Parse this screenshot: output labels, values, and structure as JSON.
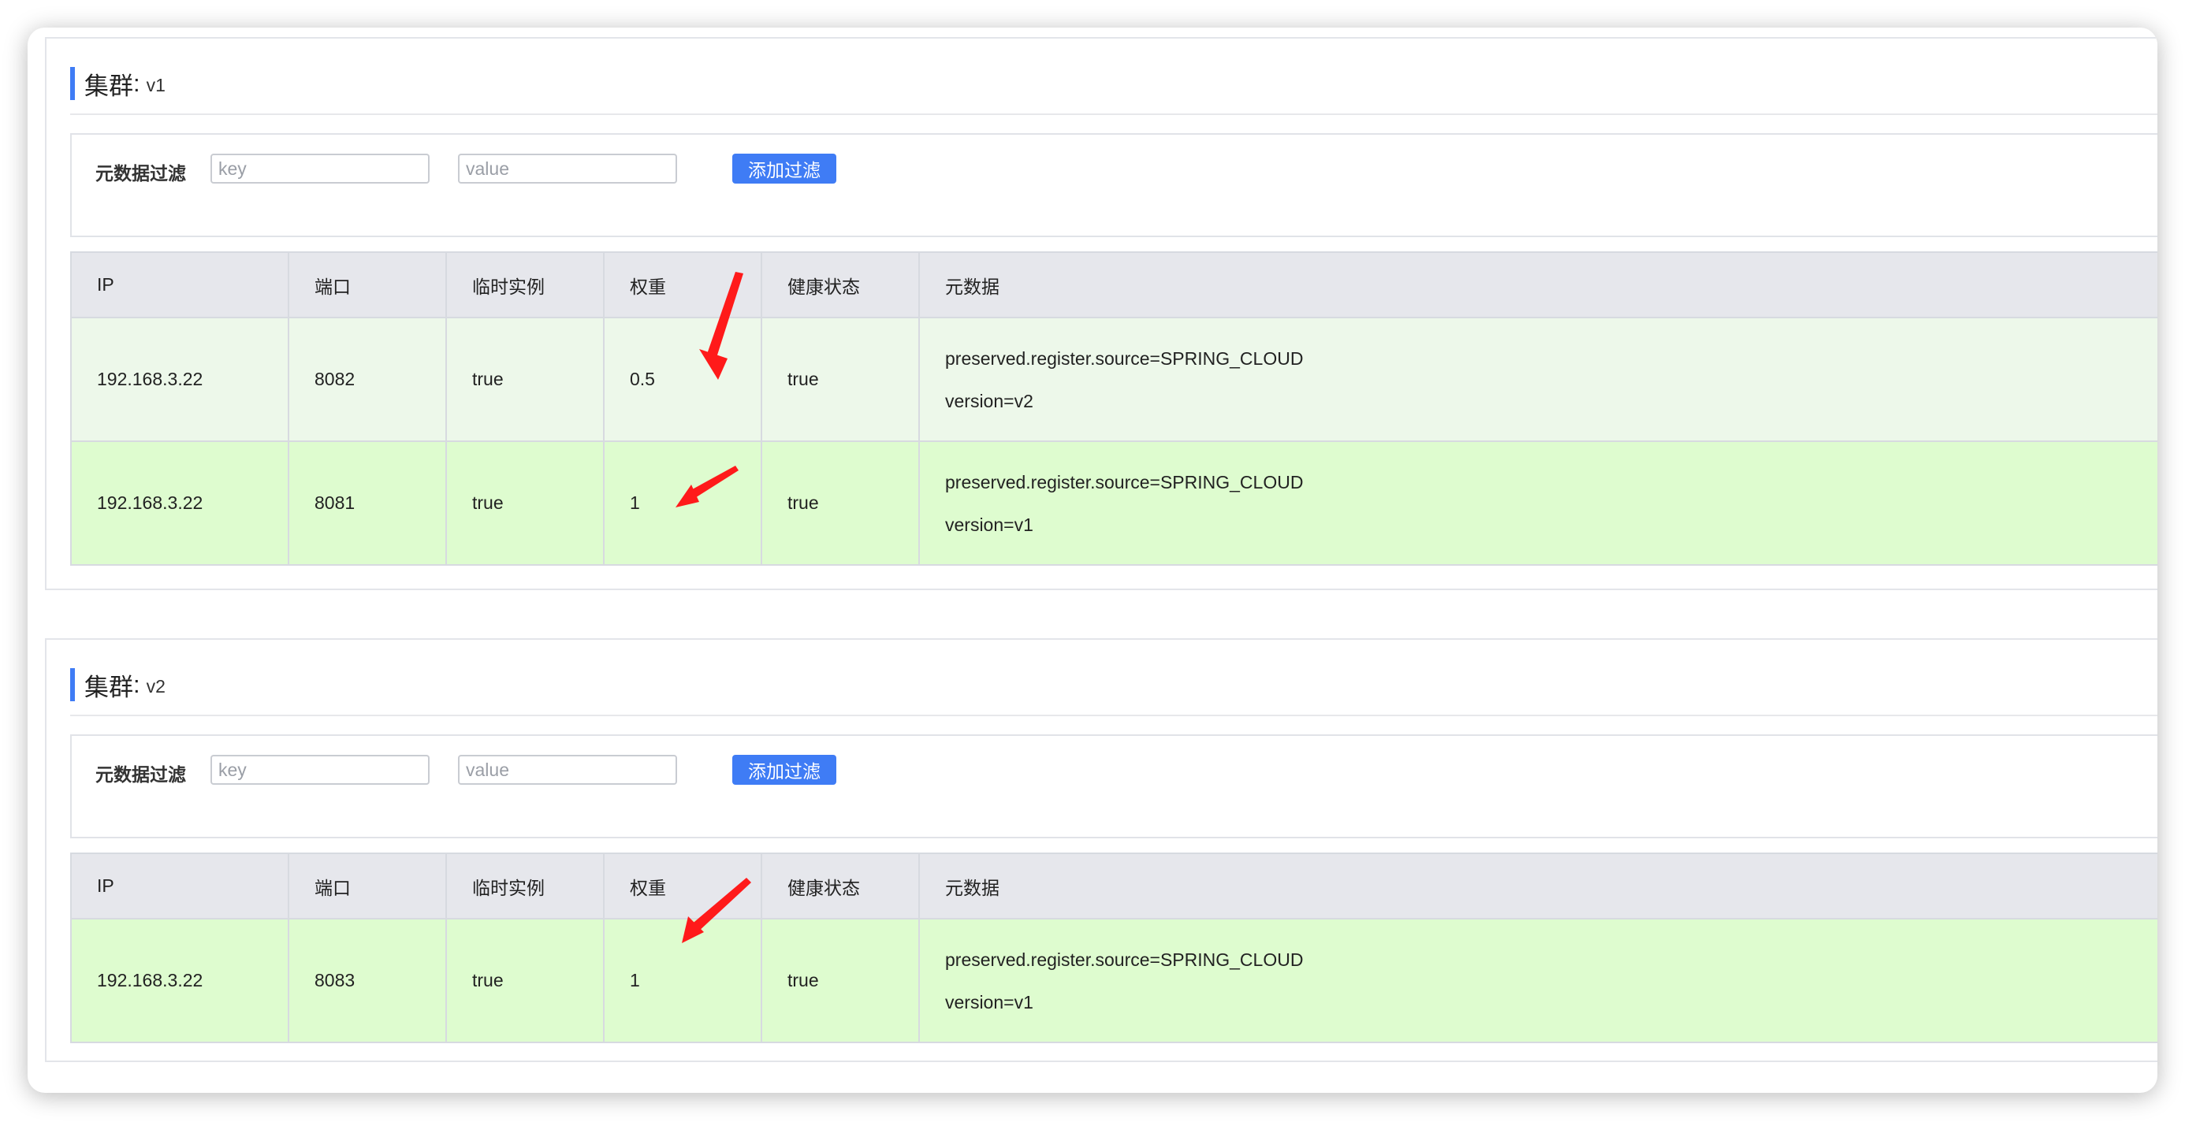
{
  "colors": {
    "accent": "#3f7cf5",
    "header_bg": "#e6e7ec",
    "row_light": "#edf8ea",
    "row_green": "#defccf",
    "annotation_arrow": "#ff0000"
  },
  "clusters": [
    {
      "title_label": "集群",
      "title_colon": ":",
      "name": "v1",
      "filter": {
        "label": "元数据过滤",
        "key_placeholder": "key",
        "value_placeholder": "value",
        "add_button": "添加过滤"
      },
      "columns": [
        "IP",
        "端口",
        "临时实例",
        "权重",
        "健康状态",
        "元数据"
      ],
      "rows": [
        {
          "ip": "192.168.3.22",
          "port": "8082",
          "ephemeral": "true",
          "weight": "0.5",
          "healthy": "true",
          "metadata": [
            "preserved.register.source=SPRING_CLOUD",
            "version=v2"
          ]
        },
        {
          "ip": "192.168.3.22",
          "port": "8081",
          "ephemeral": "true",
          "weight": "1",
          "healthy": "true",
          "metadata": [
            "preserved.register.source=SPRING_CLOUD",
            "version=v1"
          ]
        }
      ]
    },
    {
      "title_label": "集群",
      "title_colon": ":",
      "name": "v2",
      "filter": {
        "label": "元数据过滤",
        "key_placeholder": "key",
        "value_placeholder": "value",
        "add_button": "添加过滤"
      },
      "columns": [
        "IP",
        "端口",
        "临时实例",
        "权重",
        "健康状态",
        "元数据"
      ],
      "rows": [
        {
          "ip": "192.168.3.22",
          "port": "8083",
          "ephemeral": "true",
          "weight": "1",
          "healthy": "true",
          "metadata": [
            "preserved.register.source=SPRING_CLOUD",
            "version=v1"
          ]
        }
      ]
    }
  ]
}
